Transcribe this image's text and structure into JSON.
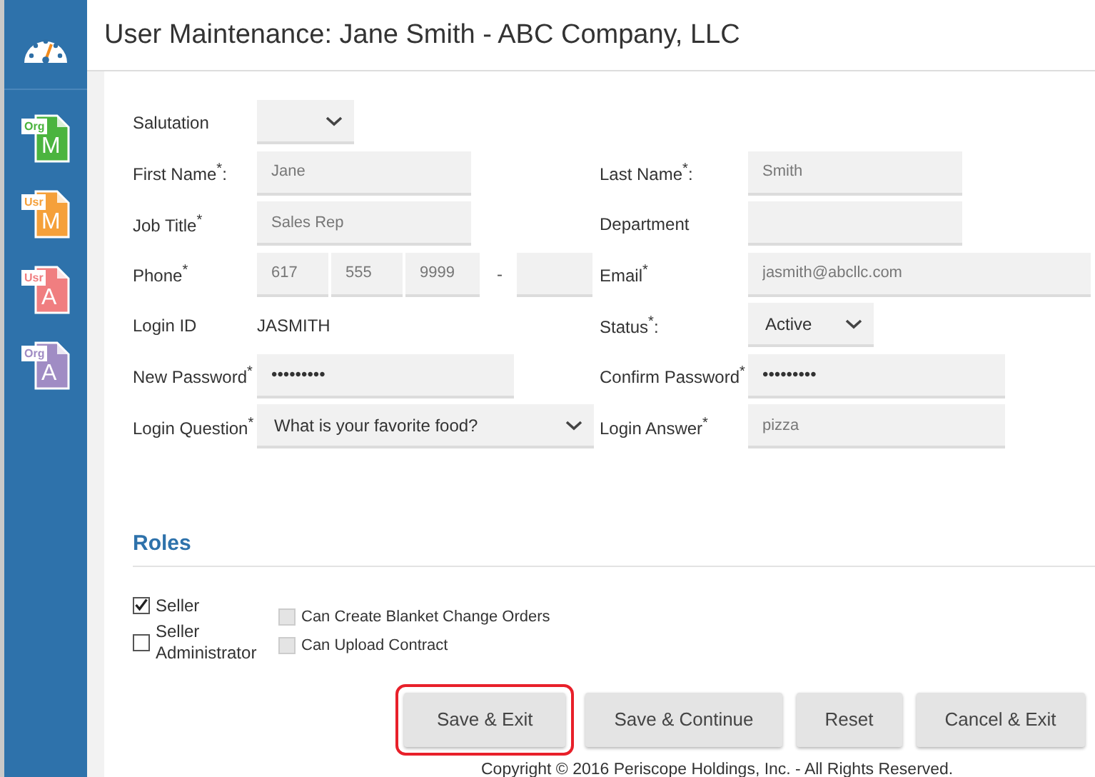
{
  "sidebar": {
    "items": [
      {
        "kind": "gauge"
      },
      {
        "kind": "document",
        "tag": "Org",
        "letter": "M",
        "color": "#4bb43f"
      },
      {
        "kind": "document",
        "tag": "Usr",
        "letter": "M",
        "color": "#f5a03a"
      },
      {
        "kind": "document",
        "tag": "Usr",
        "letter": "A",
        "color": "#f07e80"
      },
      {
        "kind": "document",
        "tag": "Org",
        "letter": "A",
        "color": "#a08cc4"
      }
    ]
  },
  "title": "User Maintenance: Jane Smith - ABC Company, LLC",
  "form": {
    "rows": [
      {
        "left": {
          "label": "Salutation",
          "kind": "select"
        },
        "right": null
      },
      {
        "left": {
          "label": "First Name$^{*}$:",
          "kind": "text",
          "value": "Jane"
        },
        "right": {
          "label": "Last Name$^{*}$:",
          "kind": "text",
          "value": "Smith"
        }
      },
      {
        "left": {
          "label": "Job Title$^{*}$",
          "kind": "text",
          "value": "Sales Rep"
        },
        "right": {
          "label": "Department",
          "kind": "text"
        }
      },
      {
        "left": {
          "label": "Phone$^{*}$",
          "kind": "phone",
          "parts": [
            "617",
            "555",
            "9999"
          ],
          "separator": "-"
        },
        "right": {
          "label": "Email$^{*}$",
          "kind": "wide",
          "value": "jasmith@abcllc.com"
        }
      },
      {
        "left": {
          "label": "Login ID",
          "kind": "static",
          "value": "JASMITH"
        },
        "right": {
          "label": "Status$^{*}$:",
          "kind": "select",
          "value": "Active"
        }
      },
      {
        "left": {
          "label": "New Password$^{*}$",
          "kind": "password",
          "value": "•••••••••"
        },
        "right": {
          "label": "Confirm Password$^{*}$",
          "kind": "password",
          "value": "•••••••••"
        }
      },
      {
        "left": {
          "label": "Login Question$^{*}$",
          "kind": "question",
          "value": "What is your favorite food?"
        },
        "right": {
          "label": "Login Answer$^{*}$",
          "kind": "password",
          "value": "pizza"
        }
      }
    ]
  },
  "roles": {
    "title": "Roles",
    "primary": [
      {
        "label": "Seller",
        "checked": true,
        "disabled": false
      },
      {
        "label": "Seller Administrator",
        "checked": false,
        "disabled": false
      }
    ],
    "secondary": [
      {
        "label": "Can Create Blanket Change Orders",
        "checked": false,
        "disabled": true
      },
      {
        "label": "Can Upload Contract",
        "checked": false,
        "disabled": true
      }
    ]
  },
  "buttons": [
    {
      "label": "Save & Exit",
      "highlighted": true
    },
    {
      "label": "Save & Continue",
      "highlighted": false
    },
    {
      "label": "Reset",
      "highlighted": false
    },
    {
      "label": "Cancel & Exit",
      "highlighted": false
    }
  ],
  "footer": "Copyright © 2016 Periscope Holdings, Inc. - All Rights Reserved."
}
